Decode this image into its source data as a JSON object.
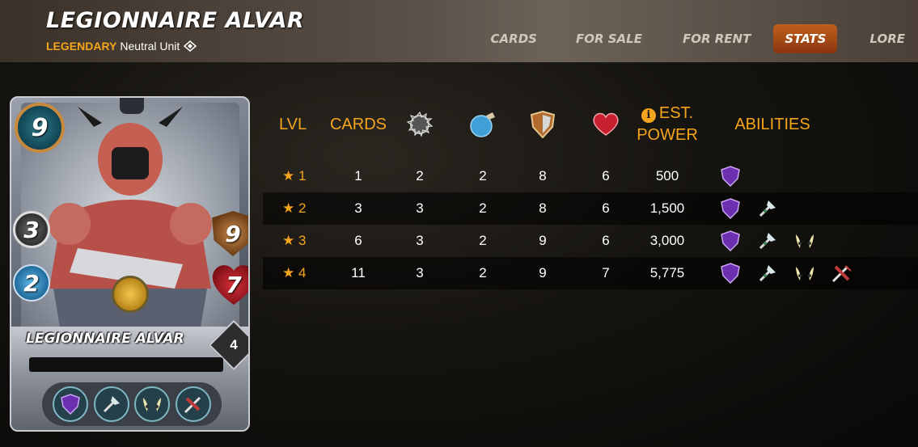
{
  "header": {
    "title": "LEGIONNAIRE ALVAR",
    "rarity": "LEGENDARY",
    "unit_type": "Neutral Unit"
  },
  "nav": {
    "items": [
      "CARDS",
      "FOR SALE",
      "FOR RENT",
      "STATS",
      "LORE"
    ],
    "active": "STATS"
  },
  "card": {
    "name": "LEGIONNAIRE ALVAR",
    "mana": "9",
    "melee": "3",
    "speed": "2",
    "armor": "9",
    "health": "7",
    "level": "4",
    "abilities": [
      "void-armor-icon",
      "cleave-icon",
      "scattershot-icon",
      "bloodlust-icon"
    ]
  },
  "table": {
    "headers": {
      "lvl": "LVL",
      "cards": "CARDS",
      "melee": "melee-attack-icon",
      "speed": "speed-icon",
      "armor": "armor-icon",
      "health": "health-icon",
      "power_line1": "EST.",
      "power_line2": "POWER",
      "abilities": "ABILITIES"
    },
    "rows": [
      {
        "lvl": "★ 1",
        "cards": "1",
        "melee": "2",
        "speed": "2",
        "armor": "8",
        "health": "6",
        "power": "500",
        "abilities": 1
      },
      {
        "lvl": "★ 2",
        "cards": "3",
        "melee": "3",
        "speed": "2",
        "armor": "8",
        "health": "6",
        "power": "1,500",
        "abilities": 2
      },
      {
        "lvl": "★ 3",
        "cards": "6",
        "melee": "3",
        "speed": "2",
        "armor": "9",
        "health": "6",
        "power": "3,000",
        "abilities": 3
      },
      {
        "lvl": "★ 4",
        "cards": "11",
        "melee": "3",
        "speed": "2",
        "armor": "9",
        "health": "7",
        "power": "5,775",
        "abilities": 4
      }
    ]
  },
  "colors": {
    "accent": "#f4a51c",
    "nav_active": "#b0501a",
    "ability_purple": "#6b2fb0",
    "ability_teal": "#7fb6c4"
  }
}
